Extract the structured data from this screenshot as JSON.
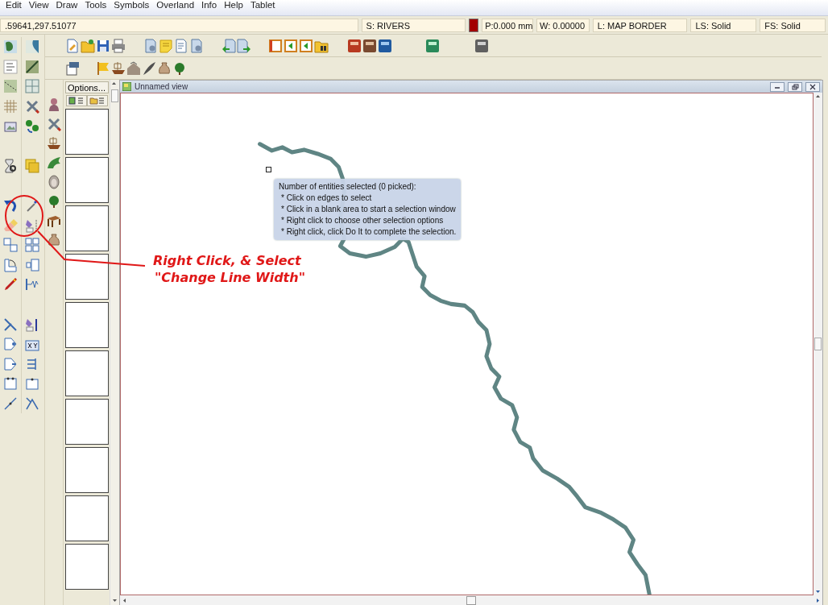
{
  "menu": [
    "Edit",
    "View",
    "Draw",
    "Tools",
    "Symbols",
    "Overland",
    "Info",
    "Help",
    "Tablet"
  ],
  "status_bar": {
    "coordinates": ".59641,297.51077",
    "sheet": "S: RIVERS",
    "color": "#a30000",
    "pen": "P:0.000 mm",
    "width": "W: 0.00000",
    "layer": "L: MAP BORDER",
    "line_style": "LS: Solid",
    "fill_style": "FS: Solid"
  },
  "options_panel": {
    "button": "Options..."
  },
  "view": {
    "title": "Unnamed view",
    "tooltip": [
      "Number of entities selected (0 picked):",
      "* Click on edges to select",
      "* Click in a blank area to start a selection window",
      "* Right click to choose other selection options",
      "* Right click, click Do It to complete the selection."
    ],
    "annotation": [
      "Right Click, & Select",
      "\"Change Line Width\""
    ]
  }
}
